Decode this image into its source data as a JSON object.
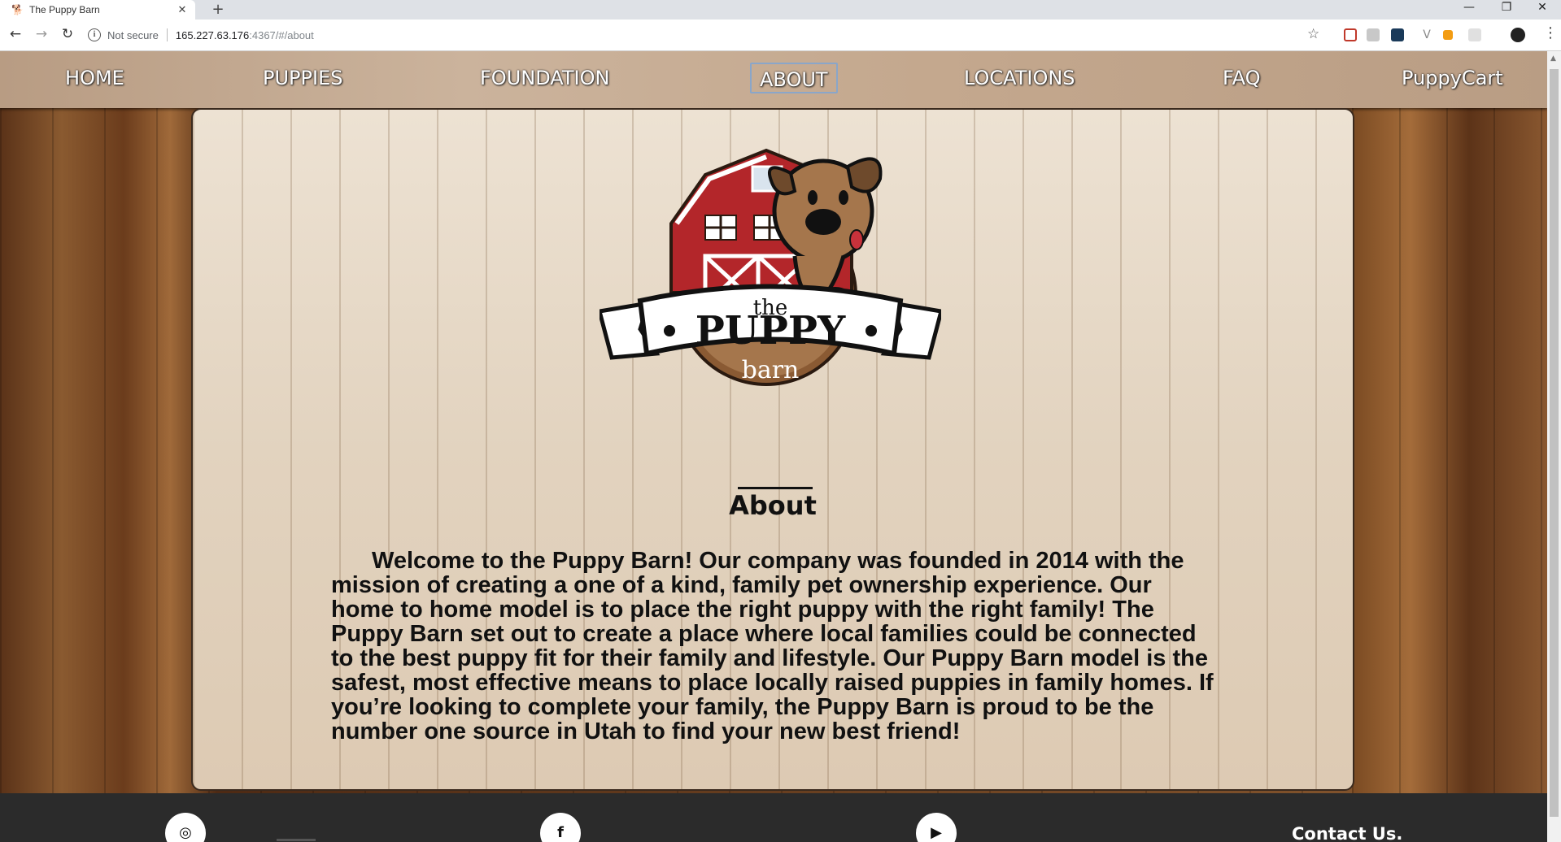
{
  "browser": {
    "tab_title": "The Puppy Barn",
    "tab_close": "✕",
    "new_tab": "+",
    "url_security": "Not secure",
    "url_host": "165.227.63.176",
    "url_path": ":4367/#/about",
    "window_minimize": "—",
    "window_restore": "❐",
    "window_close": "✕"
  },
  "nav": {
    "items": [
      {
        "label": "HOME"
      },
      {
        "label": "PUPPIES"
      },
      {
        "label": "FOUNDATION"
      },
      {
        "label": "ABOUT"
      },
      {
        "label": "LOCATIONS"
      },
      {
        "label": "FAQ"
      },
      {
        "label": "PuppyCart"
      }
    ],
    "active": "ABOUT"
  },
  "logo": {
    "line1": "the",
    "line2": "PUPPY",
    "line3": "barn"
  },
  "about": {
    "title": "About",
    "body": "Welcome to the Puppy Barn! Our company was founded in 2014 with the mission of creating a one of a kind, family pet ownership experience. Our home to home model is to place the right puppy with the right family! The Puppy Barn set out to create a place where local families could be connected to the best puppy fit for their family and lifestyle. Our Puppy Barn model is the safest, most effective means to place locally raised puppies in family homes. If you’re looking to complete your family, the Puppy Barn is proud to be the number one source in Utah to find your new best friend!"
  },
  "footer": {
    "social": [
      {
        "name": "instagram-icon",
        "glyph": "◎"
      },
      {
        "name": "facebook-icon",
        "glyph": "f"
      },
      {
        "name": "youtube-icon",
        "glyph": "▶"
      }
    ],
    "contact_label": "Contact Us."
  },
  "colors": {
    "barn_red": "#b3262a",
    "dog_brown": "#a5764c",
    "banner_white": "#ffffff",
    "footer_bg": "#2b2b2b"
  }
}
